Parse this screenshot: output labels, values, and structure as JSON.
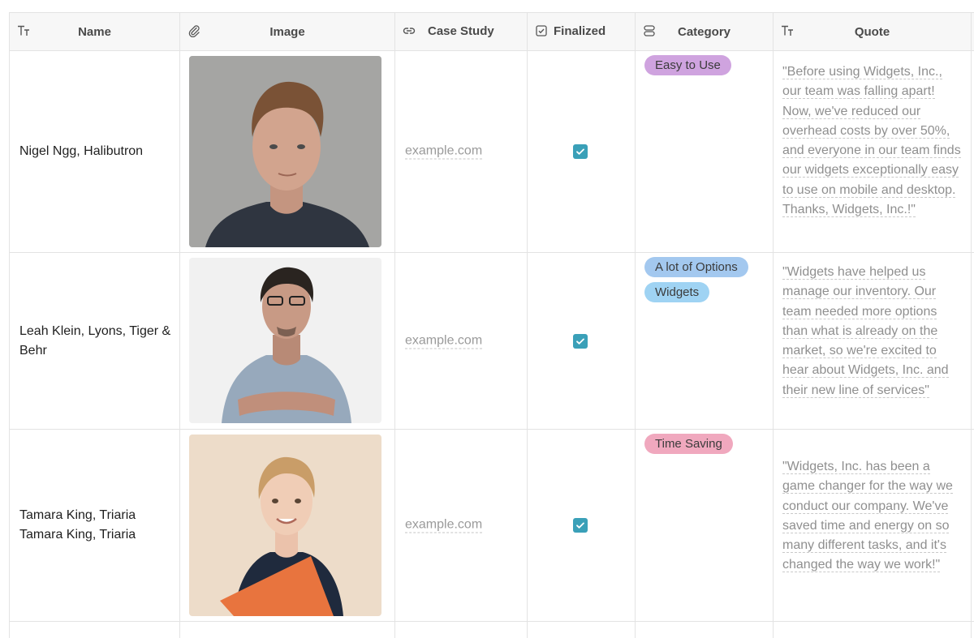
{
  "table": {
    "columns": [
      {
        "key": "name",
        "label": "Name",
        "icon": "text-type-icon"
      },
      {
        "key": "image",
        "label": "Image",
        "icon": "paperclip-icon"
      },
      {
        "key": "case_study",
        "label": "Case Study",
        "icon": "link-icon"
      },
      {
        "key": "finalized",
        "label": "Finalized",
        "icon": "checkbox-icon"
      },
      {
        "key": "category",
        "label": "Category",
        "icon": "multi-select-icon"
      },
      {
        "key": "quote",
        "label": "Quote",
        "icon": "text-type-icon"
      }
    ],
    "rows": [
      {
        "name": "Nigel Ngg, Halibutron",
        "image": "portrait-man-short-hair",
        "case_study": "example.com",
        "finalized": true,
        "categories": [
          {
            "label": "Easy to Use",
            "color": "#cfa3df"
          }
        ],
        "quote": "\"Before using Widgets, Inc., our team was falling apart! Now, we've reduced our overhead costs by over 50%, and everyone in our team finds our widgets exceptionally easy to use on mobile and desktop. Thanks, Widgets, Inc.!\""
      },
      {
        "name": "Leah Klein, Lyons, Tiger & Behr",
        "image": "portrait-man-glasses-arms-crossed",
        "case_study": "example.com",
        "finalized": true,
        "categories": [
          {
            "label": "A lot of Options",
            "color": "#a3c8ef"
          },
          {
            "label": "Widgets",
            "color": "#9fd3f3"
          }
        ],
        "quote": "\"Widgets have helped us manage our inventory. Our team needed more options than what is already on the market, so we're excited to hear about Widgets, Inc. and their new line of services\""
      },
      {
        "name": "Tamara King, Triaria\nTamara King, Triaria",
        "image": "portrait-woman-smiling-folder",
        "case_study": "example.com",
        "finalized": true,
        "categories": [
          {
            "label": "Time Saving",
            "color": "#f0a8be"
          }
        ],
        "quote": "\"Widgets, Inc. has been a game changer for the way we conduct our company. We've saved time and energy on so many different tasks, and it's changed the way we work!\""
      }
    ]
  }
}
